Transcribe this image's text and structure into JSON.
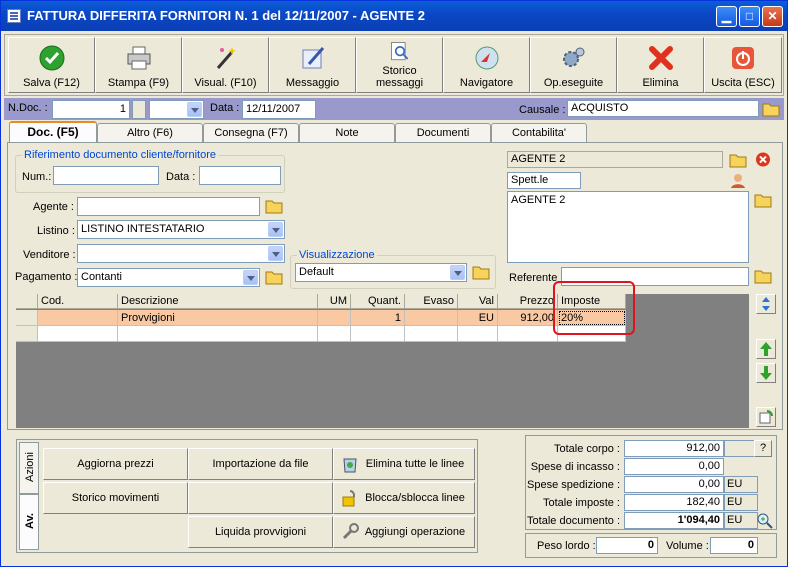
{
  "window": {
    "title": "FATTURA DIFFERITA FORNITORI N. 1   del 12/11/2007 - AGENTE 2"
  },
  "toolbar": {
    "save": "Salva (F12)",
    "print": "Stampa (F9)",
    "preview": "Visual. (F10)",
    "message": "Messaggio",
    "history_line1": "Storico",
    "history_line2": "messaggi",
    "navigator": "Navigatore",
    "done_ops": "Op.eseguite",
    "delete": "Elimina",
    "exit": "Uscita (ESC)"
  },
  "header": {
    "ndoc_label": "N.Doc. :",
    "ndoc_value": "1",
    "date_label": "Data :",
    "date_value": "12/11/2007",
    "causale_label": "Causale :",
    "causale_value": "ACQUISTO"
  },
  "tabs": [
    "Doc. (F5)",
    "Altro (F6)",
    "Consegna (F7)",
    "Note",
    "Documenti",
    "Contabilita'"
  ],
  "reference": {
    "group_title": "Riferimento documento cliente/fornitore",
    "num_label": "Num.:",
    "date_label": "Data :"
  },
  "form": {
    "agent_label": "Agente :",
    "listino_label": "Listino :",
    "listino_value": "LISTINO INTESTATARIO",
    "seller_label": "Venditore :",
    "payment_label": "Pagamento :",
    "payment_value": "Contanti",
    "view_group": "Visualizzazione",
    "view_value": "Default"
  },
  "recipient": {
    "name": "AGENTE 2",
    "salutation": "Spett.le",
    "address": "AGENTE 2",
    "referent_label": "Referente"
  },
  "grid": {
    "columns": [
      "Cod.",
      "Descrizione",
      "UM",
      "Quant.",
      "Evaso",
      "Val",
      "Prezzo",
      "Imposte"
    ],
    "rows": [
      {
        "cod": "",
        "desc": "Provvigioni",
        "um": "",
        "qty": "1",
        "evaso": "",
        "val": "EU",
        "price": "912,00",
        "tax": "20%"
      }
    ]
  },
  "actions": {
    "tab_actions": "Azioni",
    "tab_adv": "Av.",
    "update_prices": "Aggiorna prezzi",
    "import_file": "Importazione da file",
    "delete_all": "Elimina tutte le linee",
    "movements": "Storico movimenti",
    "lock_lines": "Blocca/sblocca linee",
    "liquidate": "Liquida provvigioni",
    "add_op": "Aggiungi operazione"
  },
  "totals": {
    "body_label": "Totale corpo :",
    "body_value": "912,00",
    "help": "?",
    "collection_label": "Spese di incasso :",
    "collection_value": "0,00",
    "shipping_label": "Spese spedizione :",
    "shipping_value": "0,00",
    "shipping_unit": "EU",
    "tax_label": "Totale imposte :",
    "tax_value": "182,40",
    "tax_unit": "EU",
    "doc_label": "Totale documento :",
    "doc_value": "1'094,40",
    "doc_unit": "EU",
    "gross_label": "Peso lordo :",
    "gross_value": "0",
    "volume_label": "Volume :",
    "volume_value": "0"
  }
}
